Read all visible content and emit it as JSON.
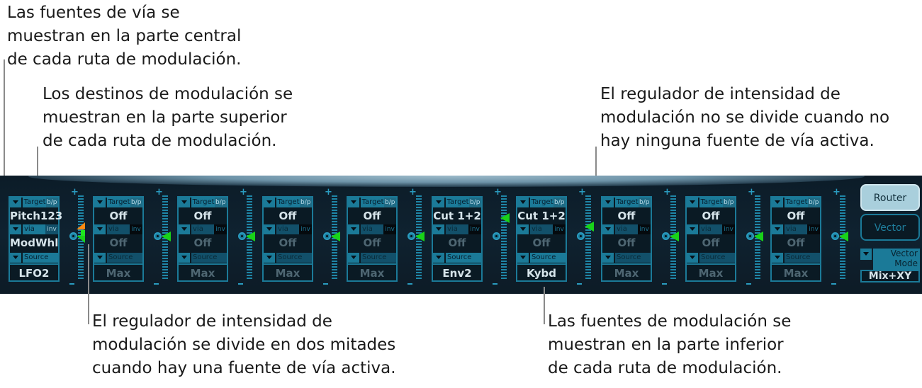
{
  "callouts": {
    "via_sources": "Las fuentes de vía se\nmuestran en la parte central\nde cada ruta de modulación.",
    "targets": "Los destinos de modulación se\nmuestran en la parte superior\nde cada ruta de modulación.",
    "slider_not_split": "El regulador de intensidad de\nmodulación no se divide cuando no\nhay ninguna fuente de vía activa.",
    "slider_split": "El regulador de intensidad de\nmodulación se divide en dos mitades\ncuando hay una fuente de vía activa.",
    "sources": "Las fuentes de modulación se\nmuestran en la parte inferior\nde cada ruta de modulación."
  },
  "labels": {
    "target": "Target",
    "bp": "b/p",
    "via": "via",
    "inv": "inv",
    "source": "Source"
  },
  "routes": [
    {
      "target": "Pitch123",
      "via": "ModWhl",
      "source": "LFO2",
      "via_active": true,
      "source_active": true
    },
    {
      "target": "Off",
      "via": "Off",
      "source": "Max",
      "via_active": false,
      "source_active": false
    },
    {
      "target": "Off",
      "via": "Off",
      "source": "Max",
      "via_active": false,
      "source_active": false
    },
    {
      "target": "Off",
      "via": "Off",
      "source": "Max",
      "via_active": false,
      "source_active": false
    },
    {
      "target": "Off",
      "via": "Off",
      "source": "Max",
      "via_active": false,
      "source_active": false
    },
    {
      "target": "Cut 1+2",
      "via": "Off",
      "source": "Env2",
      "via_active": false,
      "source_active": true
    },
    {
      "target": "Cut 1+2",
      "via": "Off",
      "source": "Kybd",
      "via_active": false,
      "source_active": true
    },
    {
      "target": "Off",
      "via": "Off",
      "source": "Max",
      "via_active": false,
      "source_active": false
    },
    {
      "target": "Off",
      "via": "Off",
      "source": "Max",
      "via_active": false,
      "source_active": false
    },
    {
      "target": "Off",
      "via": "Off",
      "source": "Max",
      "via_active": false,
      "source_active": false
    }
  ],
  "mode_buttons": {
    "router": "Router",
    "vector": "Vector"
  },
  "vector_mode": {
    "label": "Vector Mode",
    "value": "Mix+XY"
  },
  "colors": {
    "accent": "#1b7a98",
    "amount_arrow": "#19d219",
    "via_arrow": "#ff8a10"
  }
}
